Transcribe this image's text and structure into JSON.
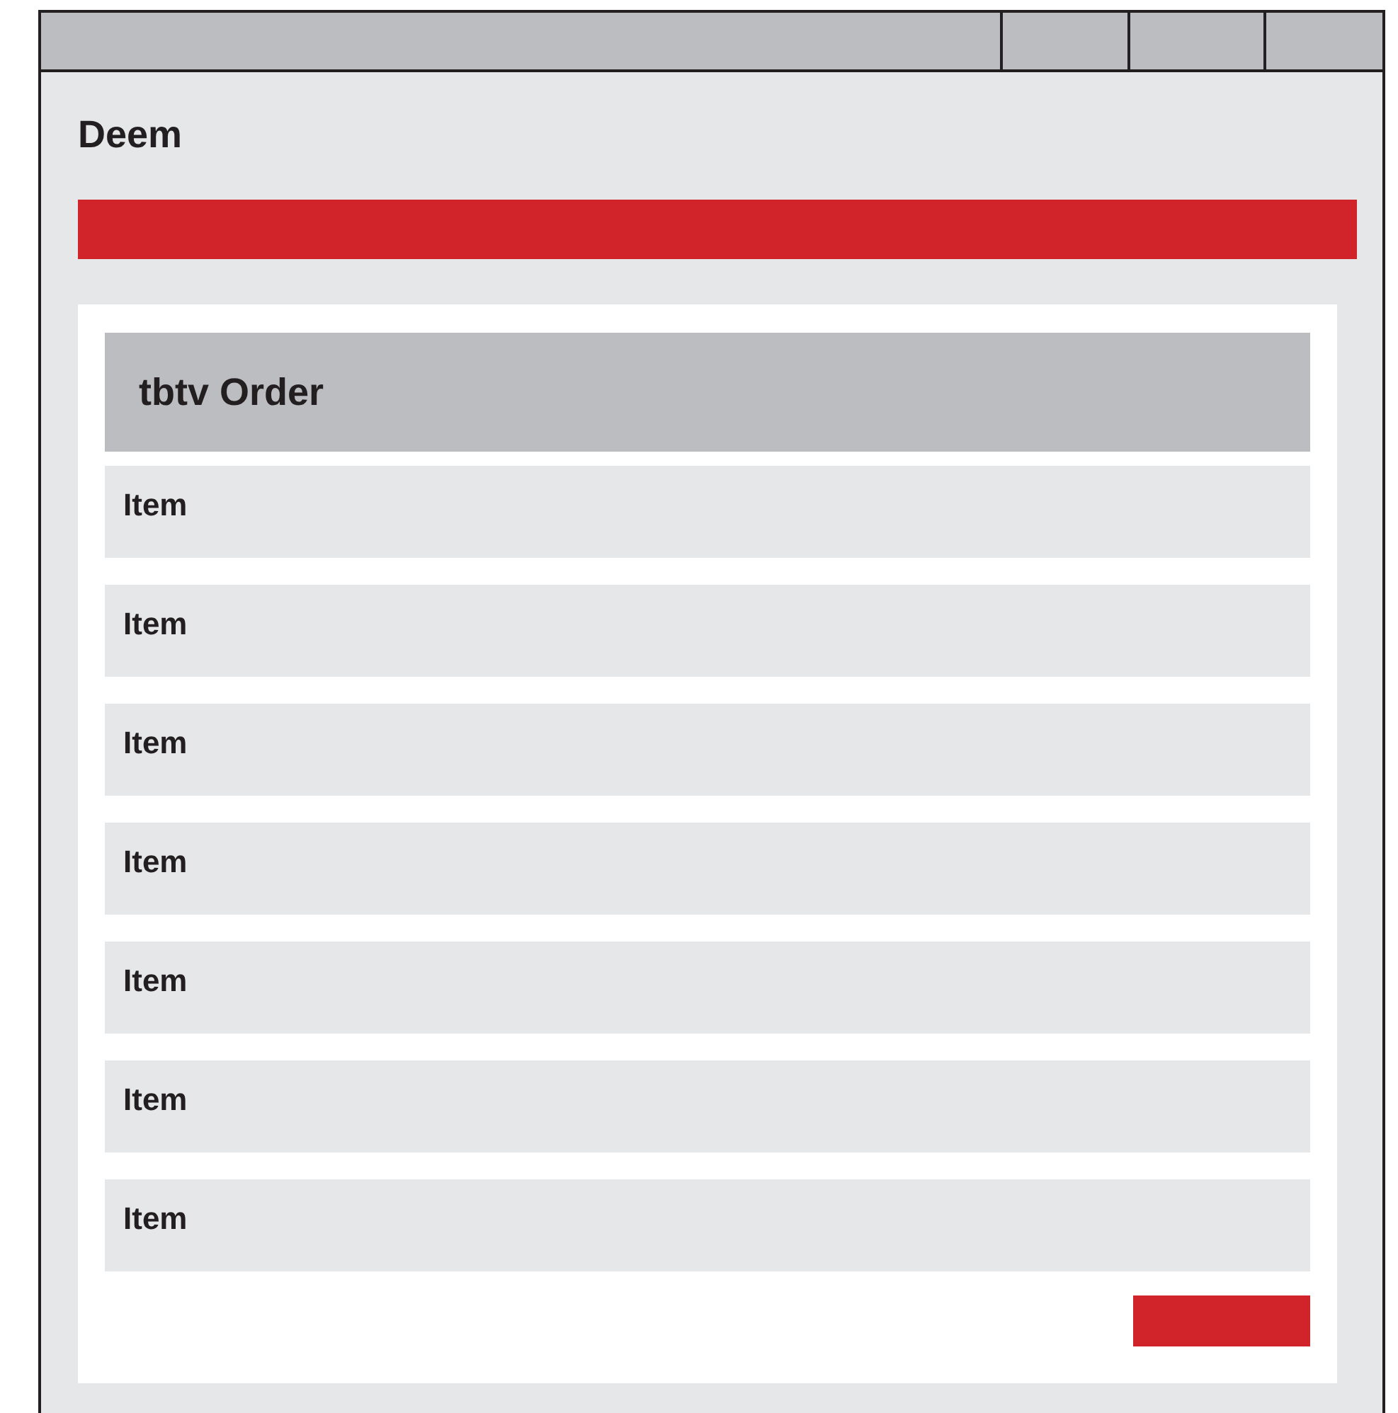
{
  "app": {
    "title": "Deem"
  },
  "order": {
    "title": "tbtv Order",
    "items": [
      {
        "label": "Item"
      },
      {
        "label": "Item"
      },
      {
        "label": "Item"
      },
      {
        "label": "Item"
      },
      {
        "label": "Item"
      },
      {
        "label": "Item"
      },
      {
        "label": "Item"
      }
    ]
  }
}
